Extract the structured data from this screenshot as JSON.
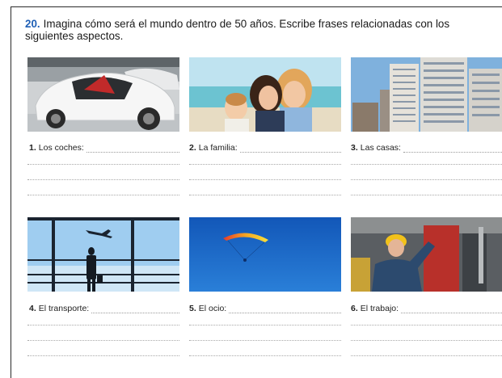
{
  "exercise": {
    "number": "20.",
    "instruction": "Imagina cómo será el mundo dentro de 50 años. Escribe frases relacionadas con los siguientes aspectos."
  },
  "items": [
    {
      "number": "1.",
      "label": "Los coches:",
      "icon": "futuristic-car"
    },
    {
      "number": "2.",
      "label": "La familia:",
      "icon": "family-beach"
    },
    {
      "number": "3.",
      "label": "Las casas:",
      "icon": "apartment-buildings"
    },
    {
      "number": "4.",
      "label": "El transporte:",
      "icon": "airport-traveler"
    },
    {
      "number": "5.",
      "label": "El ocio:",
      "icon": "paraglider-sky"
    },
    {
      "number": "6.",
      "label": "El trabajo:",
      "icon": "factory-worker"
    }
  ]
}
